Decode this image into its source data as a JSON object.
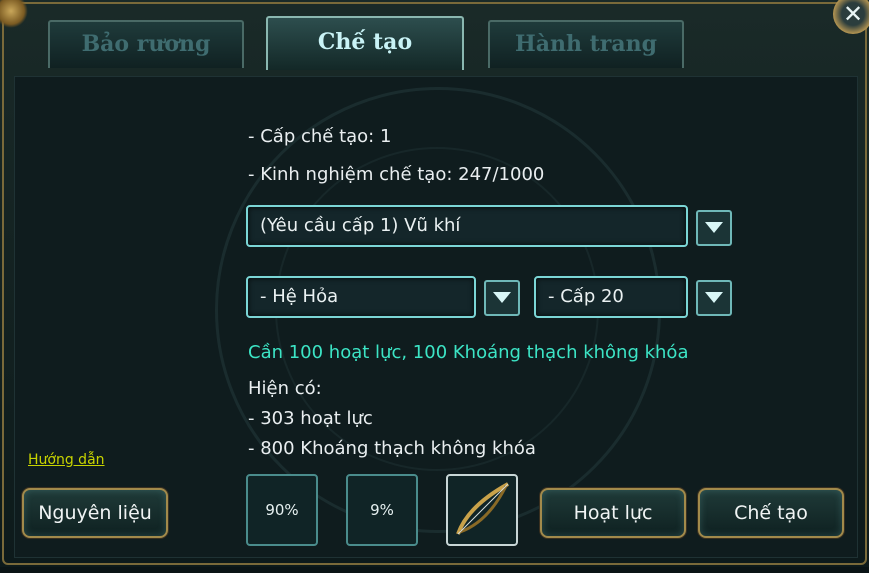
{
  "tabs": [
    {
      "label": "Bảo rương",
      "active": false
    },
    {
      "label": "Chế tạo",
      "active": true
    },
    {
      "label": "Hành trang",
      "active": false
    }
  ],
  "close_label": "✕",
  "craft_info": {
    "level": "- Cấp chế tạo: 1",
    "experience": "- Kinh nghiệm chế tạo: 247/1000"
  },
  "dropdowns": {
    "category": "(Yêu cầu cấp 1) Vũ khí",
    "element": "- Hệ Hỏa",
    "tier": "- Cấp 20"
  },
  "requirement": "Cần 100 hoạt lực, 100 Khoáng thạch không khóa",
  "inventory": {
    "heading": "Hiện có:",
    "line1": "- 303 hoạt lực",
    "line2": "- 800 Khoáng thạch không khóa"
  },
  "guide_link": "Hướng dẫn",
  "buttons": {
    "materials": "Nguyên liệu",
    "energy": "Hoạt lực",
    "craft": "Chế tạo"
  },
  "slots": {
    "rate1": "90%",
    "rate2": "9%",
    "item_icon": "bow-icon"
  },
  "colors": {
    "accent_green": "#3ce4c5",
    "frame_gold": "#a28a4b",
    "border_cyan": "#7bd6d6"
  }
}
